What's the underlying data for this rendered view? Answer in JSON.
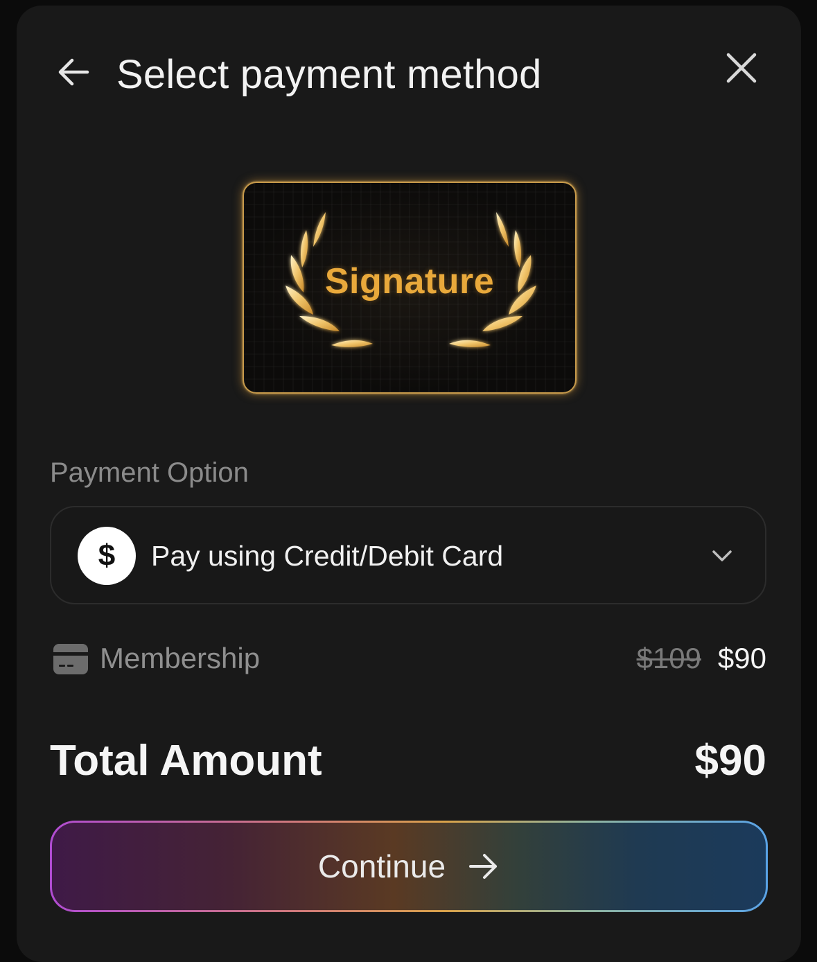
{
  "header": {
    "title": "Select payment method",
    "back_icon": "arrow-left-icon",
    "close_icon": "close-icon"
  },
  "card": {
    "label": "Signature",
    "accent_color": "#e9a93b",
    "decoration_icon": "laurel-wreath-icon"
  },
  "payment": {
    "section_label": "Payment Option",
    "selected_option": "Pay using Credit/Debit Card",
    "option_icon": "dollar-icon",
    "dropdown_icon": "chevron-down-icon"
  },
  "membership": {
    "label": "Membership",
    "icon": "credit-card-icon",
    "original_price": "$109",
    "discounted_price": "$90"
  },
  "total": {
    "label": "Total Amount",
    "value": "$90"
  },
  "continue_button": {
    "label": "Continue",
    "icon": "arrow-right-icon"
  },
  "colors": {
    "background": "#191919",
    "gold": "#e9a93b",
    "text": "#f2f2f2",
    "muted": "#8b8b8b"
  }
}
